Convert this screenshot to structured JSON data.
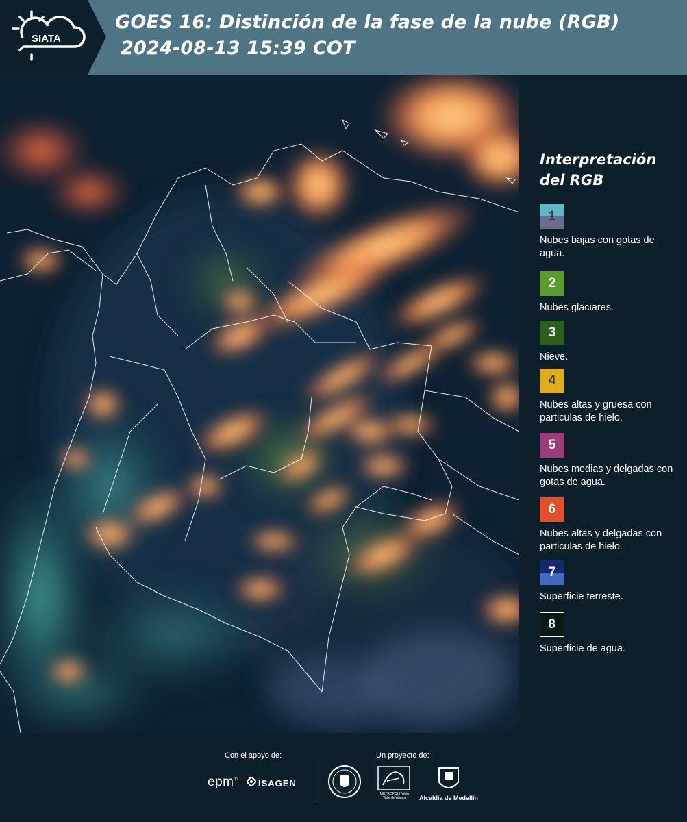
{
  "header": {
    "logo_text": "SIATA",
    "title": "GOES 16: Distinción de la fase de la nube (RGB)",
    "datetime": "2024-08-13 15:39 COT",
    "background": "#4f7585"
  },
  "legend": {
    "title_line1": "Interpretación",
    "title_line2": "del RGB",
    "items": [
      {
        "number": "1",
        "label": "Nubes bajas con gotas de agua.",
        "color_top": "#5fb6c7",
        "color_bottom": "#6b6c8c",
        "num_color": "#3a3a4e"
      },
      {
        "number": "2",
        "label": "Nubes glaciares.",
        "color_top": "#5c9a2e",
        "color_bottom": "#5c9a2e",
        "num_color": "#ffffff"
      },
      {
        "number": "3",
        "label": "Nieve.",
        "color_top": "#2d5e1c",
        "color_bottom": "#2d5e1c",
        "num_color": "#ffffff"
      },
      {
        "number": "4",
        "label": "Nubes altas y gruesa con particulas de hielo.",
        "color_top": "#e1ad1a",
        "color_bottom": "#e1ad1a",
        "num_color": "#3a3a3a"
      },
      {
        "number": "5",
        "label": "Nubes medias y delgadas con gotas de agua.",
        "color_top": "#9c3d79",
        "color_bottom": "#9c3d79",
        "num_color": "#ffffff"
      },
      {
        "number": "6",
        "label": "Nubes altas y delgadas con particulas de hielo.",
        "color_top": "#e2502a",
        "color_bottom": "#e2502a",
        "num_color": "#ffffff"
      },
      {
        "number": "7",
        "label": "Superficie terreste.",
        "color_top": "#14286a",
        "color_bottom": "#4568c4",
        "num_color": "#ffffff"
      },
      {
        "number": "8",
        "label": "Superficie de agua.",
        "color_top": "#0a1a12",
        "color_bottom": "#0a1a12",
        "num_color": "#ffffff"
      }
    ]
  },
  "footer": {
    "support_label": "Con el apoyo de:",
    "project_label": "Un proyecto de:",
    "sponsor1": "epm",
    "sponsor2": "ISAGEN",
    "partner1_caption": "METROPOLITANA Valle de Aburrá",
    "partner2": "Alcaldía de Medellín"
  }
}
